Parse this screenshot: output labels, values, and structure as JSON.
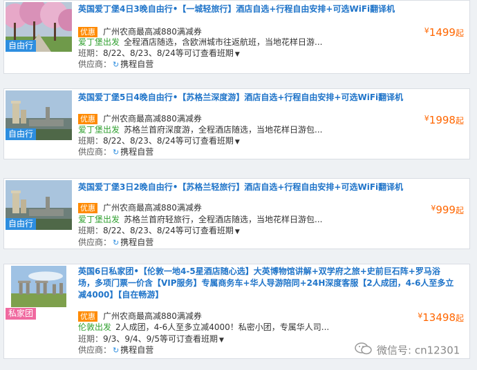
{
  "listings": [
    {
      "title": "英国爱丁堡4日3晚自由行•【一城轻旅行】酒店自选+行程自由安排+可选WiFi翻译机",
      "tag": "自由行",
      "promo_badge": "优惠",
      "promo_text": "广州农商最高减880满减券",
      "departure": "爱丁堡出发",
      "description": "全程酒店随选，含欧洲城市往返航班，当地花样日游...",
      "dates_label": "班期：",
      "dates": "8/22、8/23、8/24等可订查看班期",
      "supplier_label": "供应商：",
      "supplier": "携程自营",
      "price_symbol": "¥",
      "price": "1499",
      "price_suffix": "起"
    },
    {
      "title": "英国爱丁堡5日4晚自由行•【苏格兰深度游】酒店自选+行程自由安排+可选WiFi翻译机",
      "tag": "自由行",
      "promo_badge": "优惠",
      "promo_text": "广州农商最高减880满减券",
      "departure": "爱丁堡出发",
      "description": "苏格兰首府深度游，全程酒店随选，当地花样日游包...",
      "dates_label": "班期：",
      "dates": "8/22、8/23、8/24等可订查看班期",
      "supplier_label": "供应商：",
      "supplier": "携程自营",
      "price_symbol": "¥",
      "price": "1998",
      "price_suffix": "起"
    },
    {
      "title": "英国爱丁堡3日2晚自由行•【苏格兰轻旅行】酒店自选+行程自由安排+可选WiFi翻译机",
      "tag": "自由行",
      "promo_badge": "优惠",
      "promo_text": "广州农商最高减880满减券",
      "departure": "爱丁堡出发",
      "description": "苏格兰首府轻旅行，全程酒店随选，当地花样日游包...",
      "dates_label": "班期：",
      "dates": "8/22、8/23、8/24等可订查看班期",
      "supplier_label": "供应商：",
      "supplier": "携程自营",
      "price_symbol": "¥",
      "price": "999",
      "price_suffix": "起"
    },
    {
      "title": "英国6日私家团•【伦敦一地4-5星酒店随心选】大英博物馆讲解+双学府之旅+史前巨石阵+罗马浴场，多项门票一价含【VIP服务】专属商务车+华人导游陪同+24H深度客服【2人成团，4-6人至多立减4000】【自在畅游】",
      "tag": "私家团",
      "promo_badge": "优惠",
      "promo_text": "广州农商最高减880满减券",
      "departure": "伦敦出发",
      "description": "2人成团，4-6人至多立减4000！私密小团，专属华人司...",
      "dates_label": "班期：",
      "dates": "9/3、9/4、9/5等可订查看班期",
      "supplier_label": "供应商：",
      "supplier": "携程自营",
      "price_symbol": "¥",
      "price": "13498",
      "price_suffix": "起"
    }
  ],
  "watermark": "微信号: cn12301",
  "colors": {
    "title": "#1f74c9",
    "price": "#ff6600",
    "departure": "#30a030",
    "promo_badge": "#ff8a00",
    "tag_free": "#2d8ee0",
    "tag_private": "#f06aa0"
  },
  "icons": {
    "thumb_1": "cherry-blossom-photo",
    "thumb_2": "edinburgh-skyline-photo",
    "thumb_3": "edinburgh-skyline-photo",
    "thumb_4": "stonehenge-photo",
    "dropdown": "caret-down-icon",
    "supplier": "ctrip-logo-icon",
    "watermark": "wechat-icon"
  }
}
